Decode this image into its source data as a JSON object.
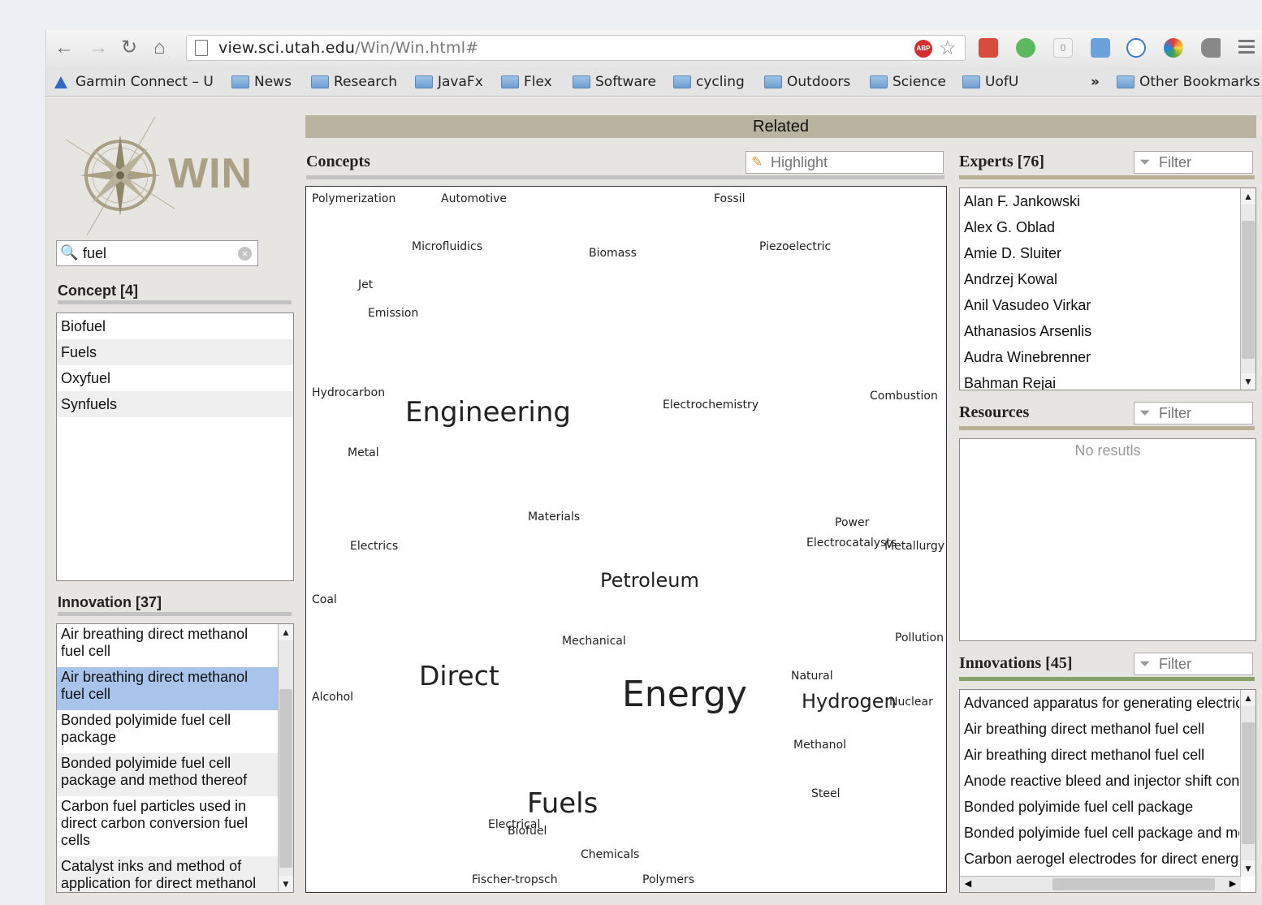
{
  "browser": {
    "url_host": "view.sci.utah.edu",
    "url_path": "/Win/Win.html#",
    "abp": "ABP",
    "counter_badge": "0",
    "bookmarks": [
      "Garmin Connect – U",
      "News",
      "Research",
      "JavaFx",
      "Flex",
      "Software",
      "cycling",
      "Outdoors",
      "Science",
      "UofU"
    ],
    "overflow": "»",
    "other_bookmarks": "Other Bookmarks"
  },
  "app": {
    "logo": "WIN",
    "search_value": "fuel",
    "concept_title": "Concept [4]",
    "concepts": [
      "Biofuel",
      "Fuels",
      "Oxyfuel",
      "Synfuels"
    ],
    "innovation_title": "Innovation [37]",
    "innovations": [
      "Air breathing direct methanol fuel cell",
      "Air breathing direct methanol fuel cell",
      "Bonded polyimide fuel cell package",
      "Bonded polyimide fuel cell package and method thereof",
      "Carbon fuel particles used in direct carbon conversion fuel cells",
      "Catalyst inks and method of application for direct methanol"
    ],
    "related_title": "Related",
    "concepts_title": "Concepts",
    "highlight_placeholder": "Highlight",
    "cloud_words": [
      {
        "text": "Polymerization",
        "size": 14
      },
      {
        "text": "Automotive",
        "size": 14
      },
      {
        "text": "Fossil",
        "size": 14
      },
      {
        "text": "Microfluidics",
        "size": 14
      },
      {
        "text": "Biomass",
        "size": 14
      },
      {
        "text": "Piezoelectric",
        "size": 14
      },
      {
        "text": "Jet",
        "size": 14
      },
      {
        "text": "Emission",
        "size": 14
      },
      {
        "text": "Hydrocarbon",
        "size": 14
      },
      {
        "text": "Engineering",
        "size": 34
      },
      {
        "text": "Electrochemistry",
        "size": 14
      },
      {
        "text": "Combustion",
        "size": 14
      },
      {
        "text": "Metal",
        "size": 14
      },
      {
        "text": "Materials",
        "size": 14
      },
      {
        "text": "Power",
        "size": 14
      },
      {
        "text": "Electrics",
        "size": 14
      },
      {
        "text": "Electrocatalysts",
        "size": 14
      },
      {
        "text": "Metallurgy",
        "size": 14
      },
      {
        "text": "Petroleum",
        "size": 24
      },
      {
        "text": "Coal",
        "size": 14
      },
      {
        "text": "Mechanical",
        "size": 14
      },
      {
        "text": "Pollution",
        "size": 14
      },
      {
        "text": "Direct",
        "size": 33
      },
      {
        "text": "Natural",
        "size": 14
      },
      {
        "text": "Alcohol",
        "size": 14
      },
      {
        "text": "Energy",
        "size": 44
      },
      {
        "text": "Hydrogen",
        "size": 24
      },
      {
        "text": "Nuclear",
        "size": 14
      },
      {
        "text": "Methanol",
        "size": 14
      },
      {
        "text": "Steel",
        "size": 14
      },
      {
        "text": "Fuels",
        "size": 34
      },
      {
        "text": "Electrical",
        "size": 14
      },
      {
        "text": "Biofuel",
        "size": 14
      },
      {
        "text": "Chemicals",
        "size": 14
      },
      {
        "text": "Fischer-tropsch",
        "size": 14
      },
      {
        "text": "Polymers",
        "size": 14
      }
    ],
    "experts_title": "Experts [76]",
    "filter_placeholder": "Filter",
    "experts": [
      "Alan F. Jankowski",
      "Alex G. Oblad",
      "Amie D. Sluiter",
      "Andrzej Kowal",
      "Anil Vasudeo Virkar",
      "Athanasios Arsenlis",
      "Audra Winebrenner",
      "Bahman Rejai"
    ],
    "resources_title": "Resources",
    "no_results": "No resutls",
    "innovations_title": "Innovations [45]",
    "innovations_right": [
      "Advanced apparatus for generating electrical",
      "Air breathing direct methanol fuel cell",
      "Air breathing direct methanol fuel cell",
      "Anode reactive bleed and injector shift control",
      "Bonded polyimide fuel cell package",
      "Bonded polyimide fuel cell package and method",
      "Carbon aerogel electrodes for direct energy"
    ],
    "icons": [
      "back-icon",
      "forward-icon",
      "reload-icon",
      "home-icon",
      "page-icon",
      "star-icon",
      "menu-icon",
      "search-icon",
      "clear-icon",
      "pencil-icon",
      "filter-icon",
      "compass-icon"
    ]
  }
}
